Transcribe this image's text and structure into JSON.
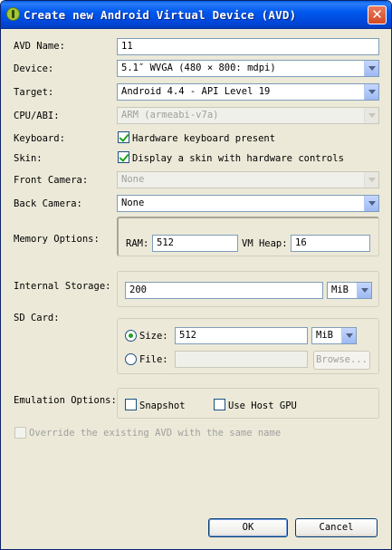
{
  "window": {
    "title": "Create new Android Virtual Device (AVD)",
    "close_label": "✕"
  },
  "avd_name": {
    "label": "AVD Name:",
    "value": "11"
  },
  "device": {
    "label": "Device:",
    "value": "5.1″ WVGA (480 × 800: mdpi)"
  },
  "target": {
    "label": "Target:",
    "value": "Android 4.4 - API Level 19"
  },
  "cpu_abi": {
    "label": "CPU/ABI:",
    "value": "ARM (armeabi-v7a)"
  },
  "keyboard": {
    "label": "Keyboard:",
    "checkbox_label": "Hardware keyboard present",
    "checked": true
  },
  "skin": {
    "label": "Skin:",
    "checkbox_label": "Display a skin with hardware controls",
    "checked": true
  },
  "front_camera": {
    "label": "Front Camera:",
    "value": "None"
  },
  "back_camera": {
    "label": "Back Camera:",
    "value": "None"
  },
  "memory": {
    "label": "Memory Options:",
    "ram_label": "RAM:",
    "ram_value": "512",
    "vm_heap_label": "VM Heap:",
    "vm_heap_value": "16"
  },
  "internal_storage": {
    "label": "Internal Storage:",
    "value": "200",
    "unit": "MiB"
  },
  "sd_card": {
    "label": "SD Card:",
    "size_label": "Size:",
    "size_value": "512",
    "size_unit": "MiB",
    "file_label": "File:",
    "file_value": "",
    "browse_label": "Browse..."
  },
  "emulation": {
    "label": "Emulation Options:",
    "snapshot_label": "Snapshot",
    "use_host_gpu_label": "Use Host GPU"
  },
  "override_label": "Override the existing AVD with the same name",
  "buttons": {
    "ok": "OK",
    "cancel": "Cancel"
  }
}
